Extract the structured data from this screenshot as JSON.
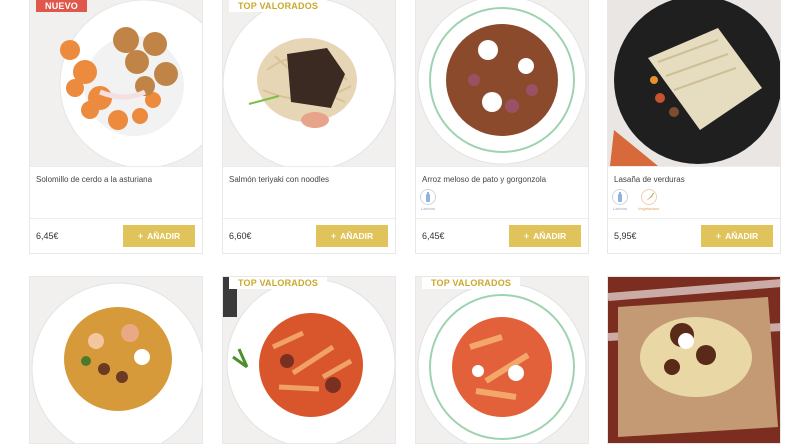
{
  "cards": [
    {
      "badge": "NUEVO",
      "title": "Solomillo de cerdo a la asturiana",
      "price": "6,45€",
      "button": "AÑADIR",
      "plus": "+"
    },
    {
      "badge": "TOP VALORADOS",
      "title": "Salmón teriyaki con noodles",
      "price": "6,60€",
      "button": "AÑADIR",
      "plus": "+"
    },
    {
      "badge": "",
      "title": "Arroz meloso de pato y gorgonzola",
      "price": "6,45€",
      "button": "AÑADIR",
      "plus": "+",
      "icons": [
        "Lácteos"
      ]
    },
    {
      "badge": "",
      "title": "Lasaña de verduras",
      "price": "5,95€",
      "button": "AÑADIR",
      "plus": "+",
      "icons": [
        "Lácteos",
        "Vegetariano"
      ]
    },
    {
      "badge": ""
    },
    {
      "badge": "TOP VALORADOS"
    },
    {
      "badge": "TOP VALORADOS"
    },
    {
      "badge": ""
    }
  ],
  "colors": {
    "accent": "#e0c35a",
    "new_badge": "#e0574c",
    "top_text": "#c9a92c"
  }
}
